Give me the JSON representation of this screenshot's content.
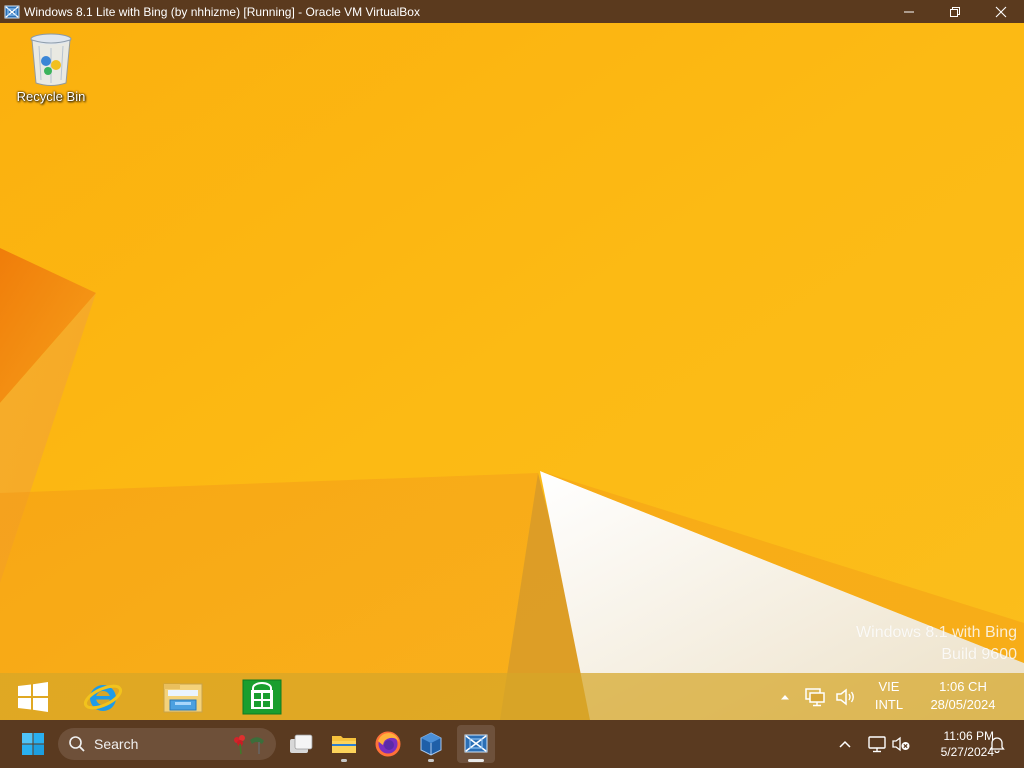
{
  "vbox_window": {
    "title": "Windows 8.1 Lite with Bing (by nhhizme) [Running] - Oracle VM VirtualBox",
    "controls": {
      "minimize": "minimize-icon",
      "restore": "restore-icon",
      "close": "close-icon"
    }
  },
  "guest": {
    "desktop_icons": [
      {
        "label": "Recycle Bin",
        "icon": "recycle-bin-icon"
      }
    ],
    "watermark": {
      "line1": "Windows 8.1 with Bing",
      "line2": "Build 9600"
    },
    "taskbar": {
      "pinned": [
        {
          "name": "start",
          "icon": "windows-logo-icon"
        },
        {
          "name": "internet-explorer",
          "icon": "internet-explorer-icon"
        },
        {
          "name": "file-explorer",
          "icon": "folder-icon"
        },
        {
          "name": "store",
          "icon": "store-icon"
        }
      ],
      "tray": {
        "icons": [
          "chevron-up-icon",
          "network-icon",
          "volume-icon"
        ],
        "language": {
          "line1": "VIE",
          "line2": "INTL"
        },
        "clock": {
          "time": "1:06 CH",
          "date": "28/05/2024"
        }
      }
    }
  },
  "host": {
    "taskbar": {
      "search_placeholder": "Search",
      "apps": [
        {
          "name": "start",
          "icon": "windows-logo-icon"
        },
        {
          "name": "task-view",
          "icon": "task-view-icon"
        },
        {
          "name": "file-explorer",
          "icon": "folder-icon"
        },
        {
          "name": "firefox",
          "icon": "firefox-icon"
        },
        {
          "name": "virtualbox-manager",
          "icon": "virtualbox-icon"
        },
        {
          "name": "virtualbox-vm",
          "icon": "virtualbox-vm-icon"
        }
      ],
      "tray": {
        "icons": [
          "chevron-up-icon",
          "network-icon",
          "volume-muted-icon",
          "notification-bell-icon"
        ],
        "clock": {
          "time": "11:06 PM",
          "date": "5/27/2024"
        }
      }
    }
  },
  "colors": {
    "wallpaper_base": "#fbb610",
    "wallpaper_dark": "#f08a0c",
    "wallpaper_light_face": "#f1e7d2",
    "host_taskbar": "#5a3a20",
    "vbox_titlebar": "#5b3a1e"
  }
}
